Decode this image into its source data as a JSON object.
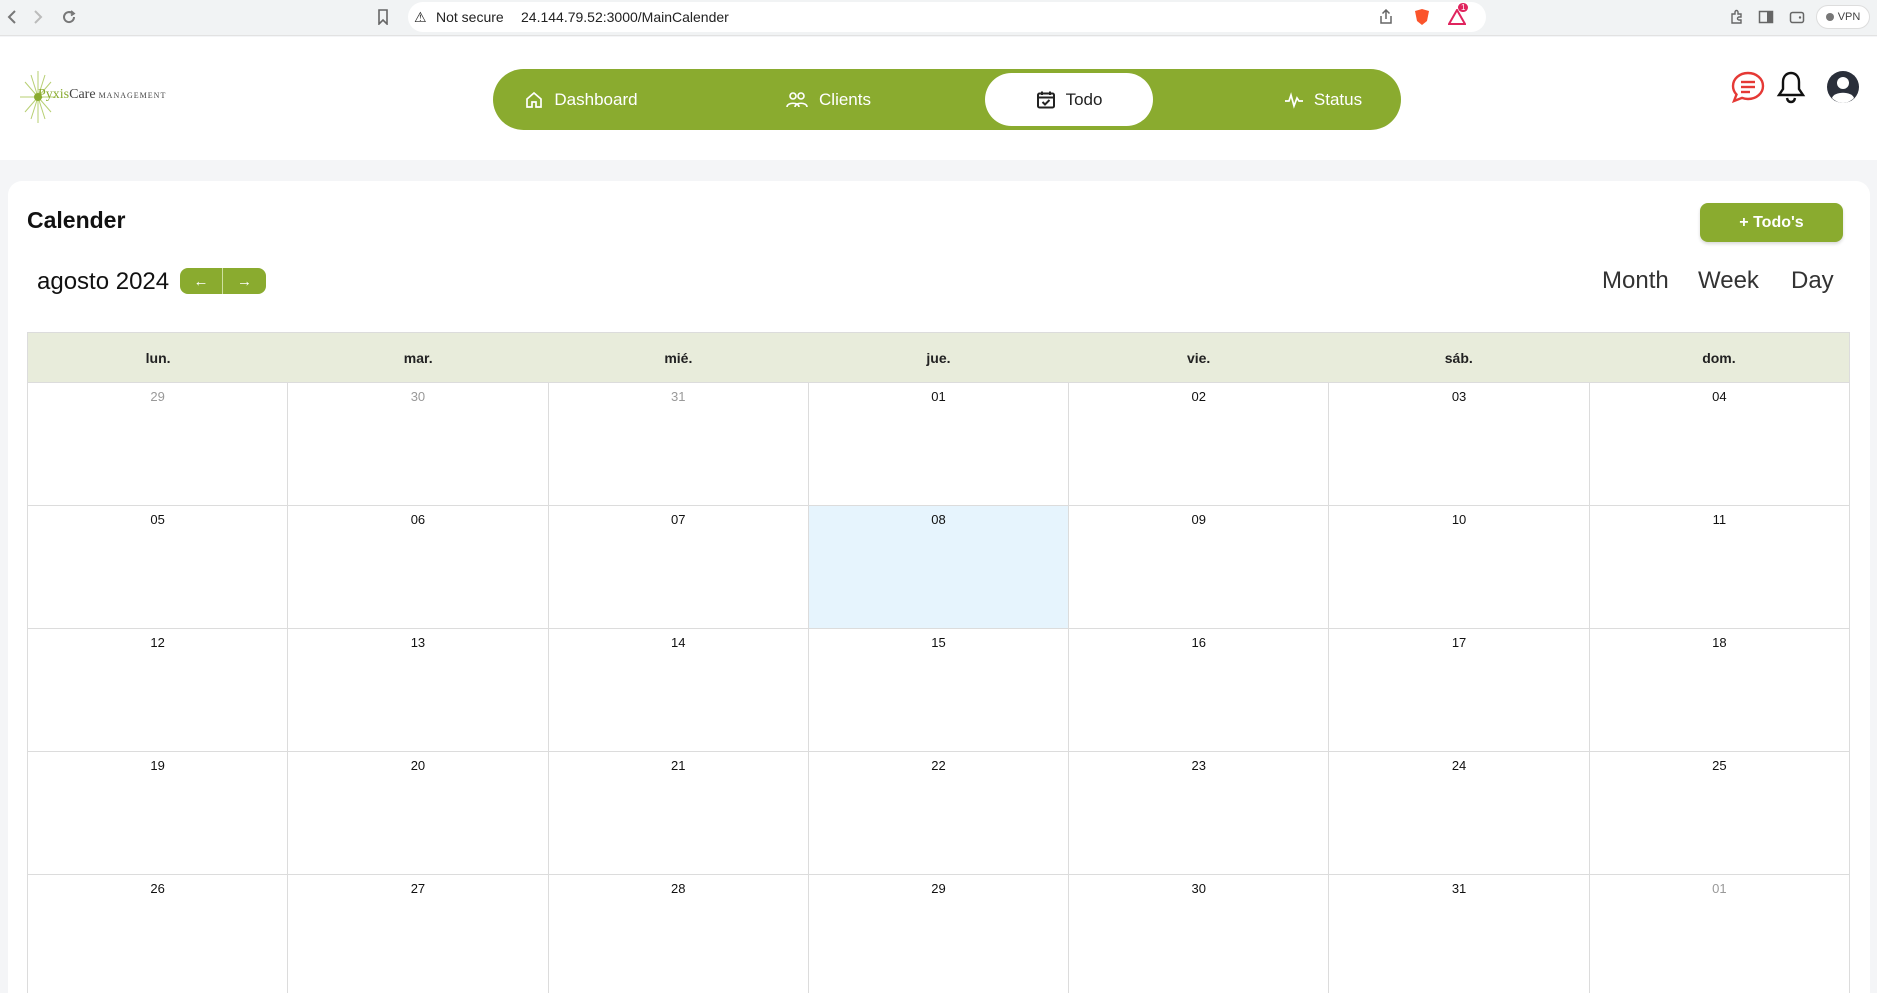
{
  "browser": {
    "security_label": "Not secure",
    "url": "24.144.79.52:3000/MainCalender",
    "vpn_label": "VPN",
    "notif_count": "1"
  },
  "brand": {
    "name_part1": "Pyxis",
    "name_part2": "Care",
    "name_part3": "MANAGEMENT"
  },
  "nav": {
    "items": [
      {
        "label": "Dashboard",
        "icon": "home-icon"
      },
      {
        "label": "Clients",
        "icon": "users-icon"
      },
      {
        "label": "Todo",
        "icon": "calendar-check-icon"
      },
      {
        "label": "Status",
        "icon": "activity-icon"
      }
    ],
    "active": "Todo"
  },
  "page": {
    "title": "Calender",
    "add_button": "+ Todo's",
    "month_label": "agosto 2024",
    "prev_arrow": "←",
    "next_arrow": "→",
    "views": [
      "Month",
      "Week",
      "Day"
    ]
  },
  "calendar": {
    "weekdays": [
      "lun.",
      "mar.",
      "mié.",
      "jue.",
      "vie.",
      "sáb.",
      "dom."
    ],
    "weeks": [
      [
        {
          "d": "29",
          "muted": true
        },
        {
          "d": "30",
          "muted": true
        },
        {
          "d": "31",
          "muted": true
        },
        {
          "d": "01"
        },
        {
          "d": "02"
        },
        {
          "d": "03"
        },
        {
          "d": "04"
        }
      ],
      [
        {
          "d": "05"
        },
        {
          "d": "06"
        },
        {
          "d": "07"
        },
        {
          "d": "08",
          "today": true
        },
        {
          "d": "09"
        },
        {
          "d": "10"
        },
        {
          "d": "11"
        }
      ],
      [
        {
          "d": "12"
        },
        {
          "d": "13"
        },
        {
          "d": "14"
        },
        {
          "d": "15"
        },
        {
          "d": "16"
        },
        {
          "d": "17"
        },
        {
          "d": "18"
        }
      ],
      [
        {
          "d": "19"
        },
        {
          "d": "20"
        },
        {
          "d": "21"
        },
        {
          "d": "22"
        },
        {
          "d": "23"
        },
        {
          "d": "24"
        },
        {
          "d": "25"
        }
      ],
      [
        {
          "d": "26"
        },
        {
          "d": "27"
        },
        {
          "d": "28"
        },
        {
          "d": "29"
        },
        {
          "d": "30"
        },
        {
          "d": "31"
        },
        {
          "d": "01",
          "muted": true
        }
      ]
    ]
  },
  "colors": {
    "accent": "#8aab2f",
    "today_bg": "#e6f4fd",
    "header_row_bg": "#e8ecdb",
    "chat_icon": "#e53935"
  }
}
